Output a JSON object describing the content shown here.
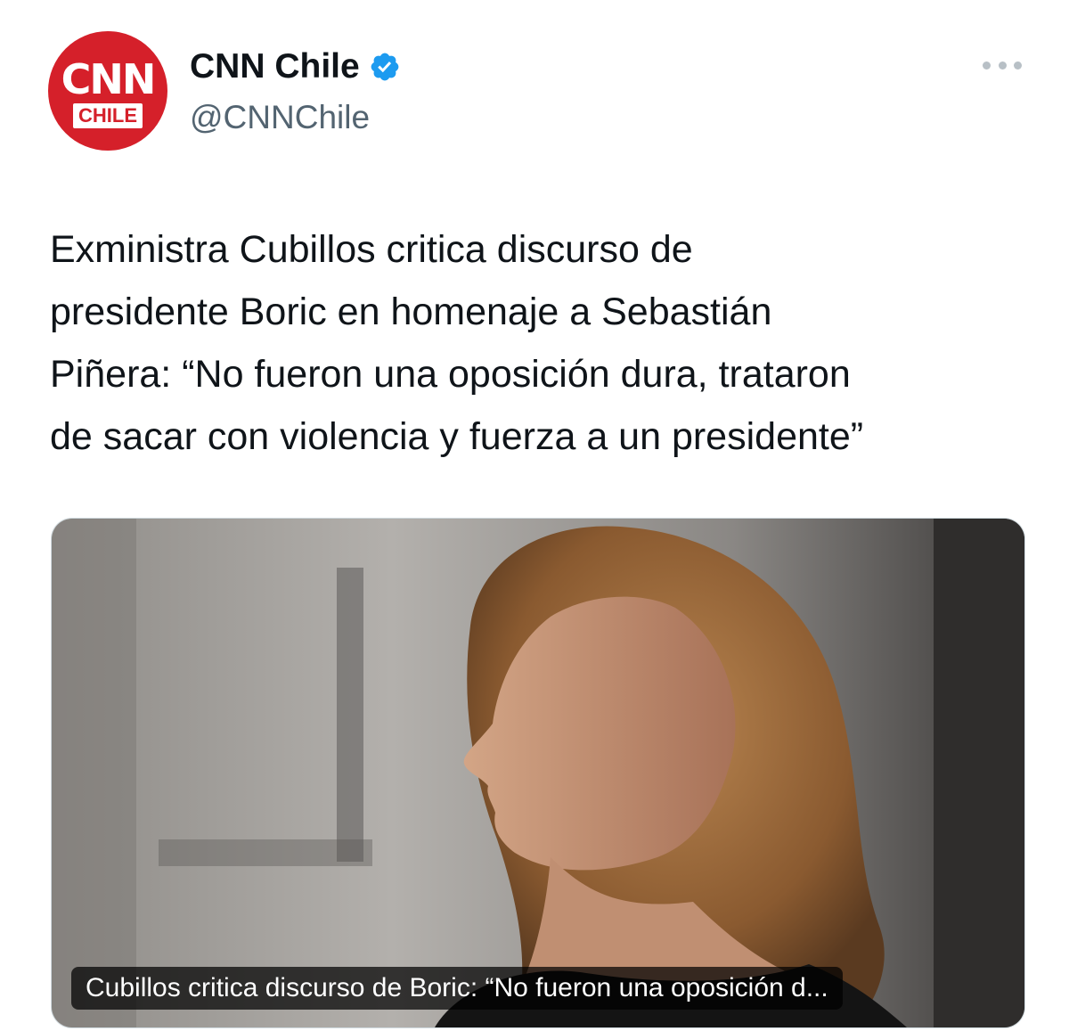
{
  "account": {
    "display_name": "CNN Chile",
    "handle": "@CNNChile",
    "avatar_text_top": "CNN",
    "avatar_text_bottom": "CHILE",
    "verified": true,
    "brand_color": "#d5202a",
    "verified_color": "#1d9bf0"
  },
  "menu": {
    "icon": "more-horizontal-icon"
  },
  "tweet": {
    "text": "Exministra Cubillos critica discurso de\npresidente Boric en homenaje a Sebastián\nPiñera: “No fueron una oposición dura, trataron\nde sacar con violencia y fuerza a un presidente”"
  },
  "link_card": {
    "title": "Cubillos critica discurso de Boric: “No fueron una oposición d...",
    "image": "photo-woman-profile"
  }
}
